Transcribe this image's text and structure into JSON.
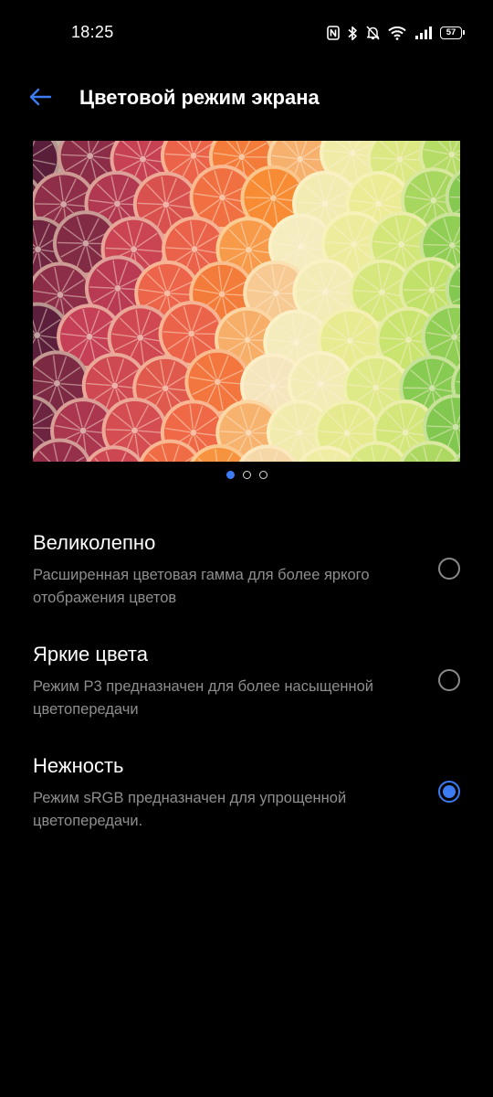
{
  "status_bar": {
    "time": "18:25",
    "icons": [
      "nfc-icon",
      "bluetooth-icon",
      "mute-icon",
      "wifi-icon",
      "signal-icon"
    ],
    "battery": "57"
  },
  "header": {
    "title": "Цветовой режим экрана",
    "back_icon": "back-arrow-icon",
    "accent_color": "#3d7bf2"
  },
  "preview": {
    "pager_count": 3,
    "active_page": 1
  },
  "options": [
    {
      "title": "Великолепно",
      "description": "Расширенная цветовая гамма для более яркого отображения цветов",
      "selected": false
    },
    {
      "title": "Яркие цвета",
      "description": "Режим P3 предназначен для более насыщенной цветопередачи",
      "selected": false
    },
    {
      "title": "Нежность",
      "description": "Режим sRGB предназначен для упрощенной цветопередачи.",
      "selected": true
    }
  ]
}
